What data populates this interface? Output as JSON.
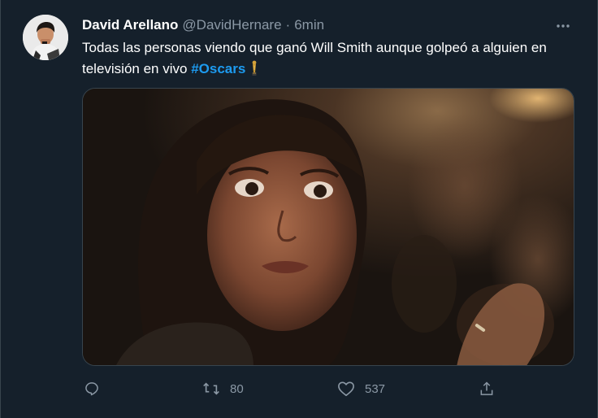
{
  "tweet": {
    "author_name": "David Arellano",
    "author_handle": "@DavidHernare",
    "separator": "·",
    "time": "6min",
    "text": "Todas las personas viendo que ganó Will Smith aunque golpeó a alguien en televisión en vivo ",
    "hashtag": "#Oscars",
    "emoji": "trophy-emoji"
  },
  "actions": {
    "reply": {
      "icon": "reply-icon",
      "count": ""
    },
    "retweet": {
      "icon": "retweet-icon",
      "count": "80"
    },
    "like": {
      "icon": "heart-icon",
      "count": "537"
    },
    "share": {
      "icon": "share-icon",
      "count": ""
    }
  },
  "colors": {
    "background": "#15202b",
    "text": "#ffffff",
    "secondary_text": "#8b98a5",
    "accent": "#1d9bf0",
    "border": "#38444d"
  }
}
